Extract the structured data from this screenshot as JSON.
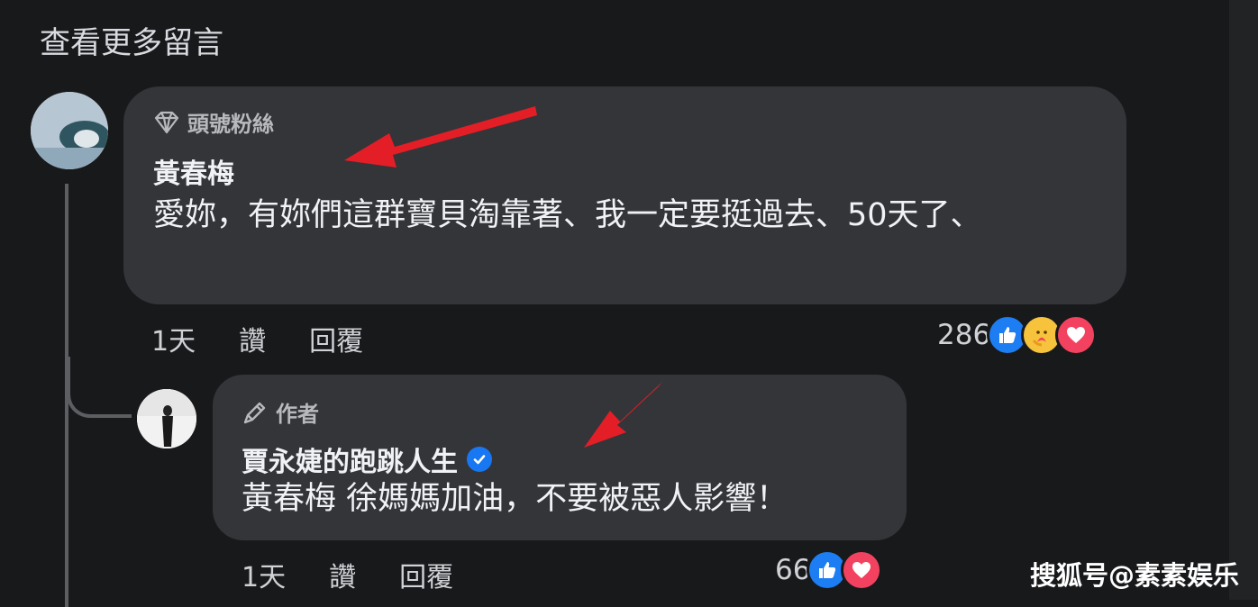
{
  "header": {
    "view_more": "查看更多留言"
  },
  "comment": {
    "badge": "頭號粉絲",
    "author": "黃春梅",
    "text": "愛妳，有妳們這群寶貝淘靠著、我一定要挺過去、50天了、",
    "time": "1天",
    "like_action": "讚",
    "reply_action": "回覆",
    "reaction_count": "286",
    "reactions": [
      "like-icon",
      "care-icon",
      "love-icon"
    ]
  },
  "reply": {
    "badge": "作者",
    "author": "賈永婕的跑跳人生",
    "verified": true,
    "text": "黃春梅 徐媽媽加油，不要被惡人影響！",
    "time": "1天",
    "like_action": "讚",
    "reply_action": "回覆",
    "reaction_count": "66",
    "reactions": [
      "like-icon",
      "love-icon"
    ]
  },
  "watermark": "搜狐号@素素娱乐",
  "colors": {
    "background": "#18191b",
    "bubble": "#343539",
    "like": "#1d7df2",
    "love": "#f3425f",
    "arrow": "#e41e26"
  }
}
